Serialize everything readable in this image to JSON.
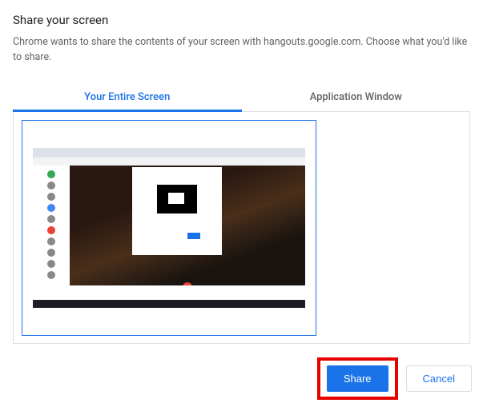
{
  "dialog": {
    "title": "Share your screen",
    "description": "Chrome wants to share the contents of your screen with hangouts.google.com. Choose what you'd like to share."
  },
  "tabs": {
    "entire_screen": "Your Entire Screen",
    "app_window": "Application Window"
  },
  "buttons": {
    "share": "Share",
    "cancel": "Cancel"
  }
}
